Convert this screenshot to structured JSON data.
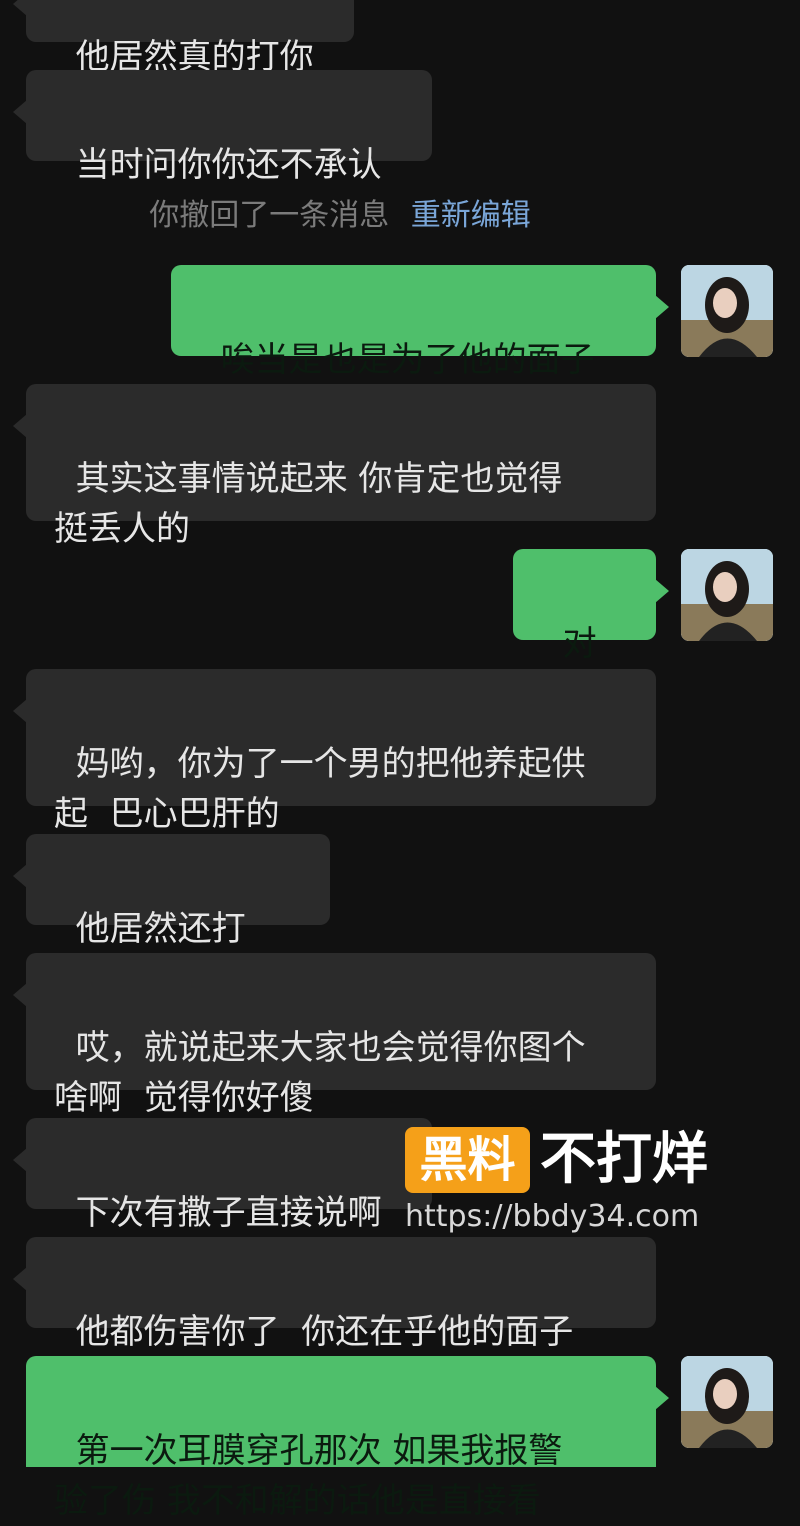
{
  "messages": [
    {
      "side": "in",
      "text": "他居然真的打你"
    },
    {
      "side": "in",
      "text": "当时问你你还不承认"
    },
    {
      "side": "out",
      "text": "唉当是也是为了他的面子"
    },
    {
      "side": "in",
      "text": "其实这事情说起来 你肯定也觉得\n挺丢人的"
    },
    {
      "side": "out",
      "text": "对啊"
    },
    {
      "side": "in",
      "text": "妈哟，你为了一个男的把他养起供\n起  巴心巴肝的"
    },
    {
      "side": "in",
      "text": "他居然还打你。"
    },
    {
      "side": "in",
      "text": "哎，就说起来大家也会觉得你图个\n啥啊  觉得你好傻"
    },
    {
      "side": "in",
      "text": "下次有撒子直接说啊"
    },
    {
      "side": "in",
      "text": "他都伤害你了  你还在乎他的面子"
    },
    {
      "side": "out",
      "text": "第一次耳膜穿孔那次 如果我报警\n验了伤 我不和解的话他是直接看"
    }
  ],
  "recall": {
    "notice": "你撤回了一条消息",
    "edit_link": "重新编辑"
  },
  "watermark": {
    "logo": "黑料",
    "name": "不打烊",
    "url": "https://bbdy34.com"
  },
  "colors": {
    "background": "#111111",
    "incoming_bubble": "#2b2b2b",
    "outgoing_bubble": "#4fbf6b",
    "link": "#7aa6d8",
    "watermark_accent": "#f5a019"
  }
}
